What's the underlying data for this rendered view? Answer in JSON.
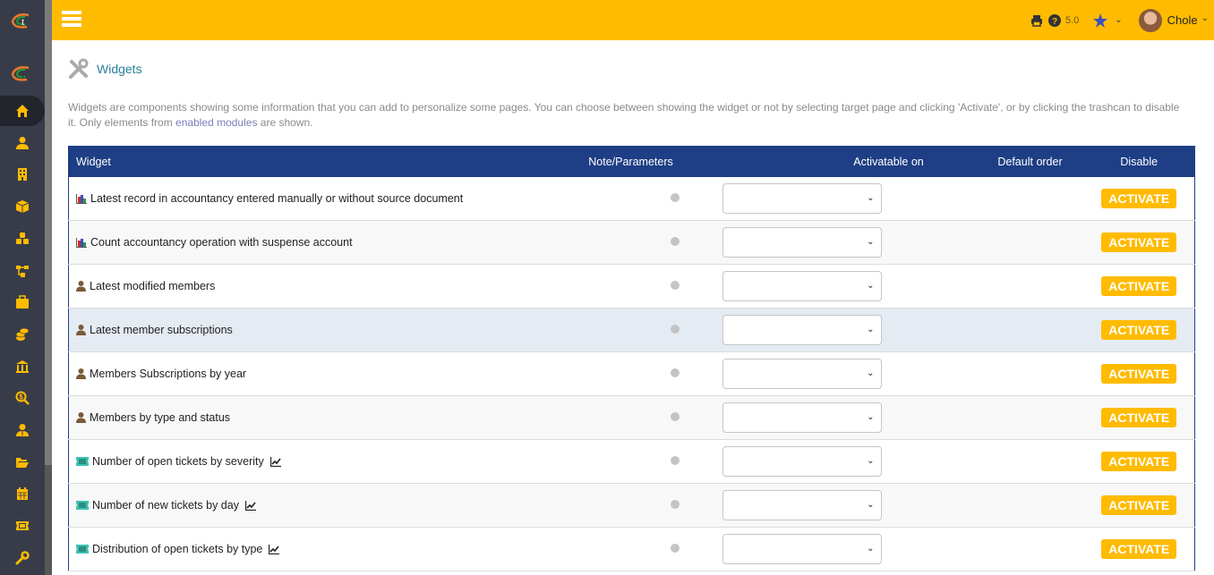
{
  "header": {
    "version": "5.0",
    "user_name": "Chole"
  },
  "page": {
    "title": "Widgets",
    "description_part1": "Widgets are components showing some information that you can add to personalize some pages. You can choose between showing the widget or not by selecting target page and clicking 'Activate', or by clicking the trashcan to disable it. Only elements from ",
    "description_link": "enabled modules",
    "description_part2": " are shown."
  },
  "sidebar": {
    "items": [
      {
        "icon": "home-icon",
        "active": true
      },
      {
        "icon": "user-icon"
      },
      {
        "icon": "building-icon"
      },
      {
        "icon": "cube-icon"
      },
      {
        "icon": "cubes-icon"
      },
      {
        "icon": "sitemap-icon"
      },
      {
        "icon": "briefcase-icon"
      },
      {
        "icon": "coins-icon"
      },
      {
        "icon": "bank-icon"
      },
      {
        "icon": "search-dollar-icon"
      },
      {
        "icon": "user-tie-icon"
      },
      {
        "icon": "folder-open-icon"
      },
      {
        "icon": "calendar-icon"
      },
      {
        "icon": "ticket-icon"
      },
      {
        "icon": "wrench-icon"
      }
    ]
  },
  "table": {
    "columns": [
      "Widget",
      "Note/Parameters",
      "Activatable on",
      "Default order",
      "Disable"
    ],
    "action_label": "ACTIVATE",
    "rows": [
      {
        "icon": "chart-bar-icon",
        "name": "Latest record in accountancy entered manually or without source document",
        "graph": false,
        "selected": ""
      },
      {
        "icon": "chart-bar-icon",
        "name": "Count accountancy operation with suspense account",
        "graph": false,
        "selected": ""
      },
      {
        "icon": "user-icon",
        "name": "Latest modified members",
        "graph": false,
        "selected": ""
      },
      {
        "icon": "user-icon",
        "name": "Latest member subscriptions",
        "graph": false,
        "selected": "",
        "hover": true
      },
      {
        "icon": "user-icon",
        "name": "Members Subscriptions by year",
        "graph": false,
        "selected": ""
      },
      {
        "icon": "user-icon",
        "name": "Members by type and status",
        "graph": false,
        "selected": ""
      },
      {
        "icon": "ticket-icon",
        "name": "Number of open tickets by severity",
        "graph": true,
        "selected": ""
      },
      {
        "icon": "ticket-icon",
        "name": "Number of new tickets by day",
        "graph": true,
        "selected": ""
      },
      {
        "icon": "ticket-icon",
        "name": "Distribution of open tickets by type",
        "graph": true,
        "selected": ""
      }
    ]
  }
}
